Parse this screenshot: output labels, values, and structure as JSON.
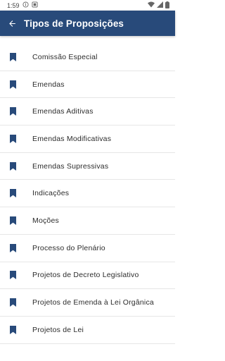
{
  "status_bar": {
    "time": "1:59"
  },
  "app_bar": {
    "title": "Tipos de Proposições"
  },
  "colors": {
    "app_bar": "#284a7a",
    "bookmark": "#284a7a"
  },
  "list": {
    "icon": "bookmark-icon",
    "items": [
      {
        "label": "Comissão Especial"
      },
      {
        "label": "Emendas"
      },
      {
        "label": "Emendas Aditivas"
      },
      {
        "label": "Emendas Modificativas"
      },
      {
        "label": "Emendas Supressivas"
      },
      {
        "label": "Indicações"
      },
      {
        "label": "Moções"
      },
      {
        "label": "Processo do Plenário"
      },
      {
        "label": "Projetos de Decreto Legislativo"
      },
      {
        "label": "Projetos de Emenda à Lei Orgânica"
      },
      {
        "label": "Projetos de Lei"
      }
    ]
  }
}
